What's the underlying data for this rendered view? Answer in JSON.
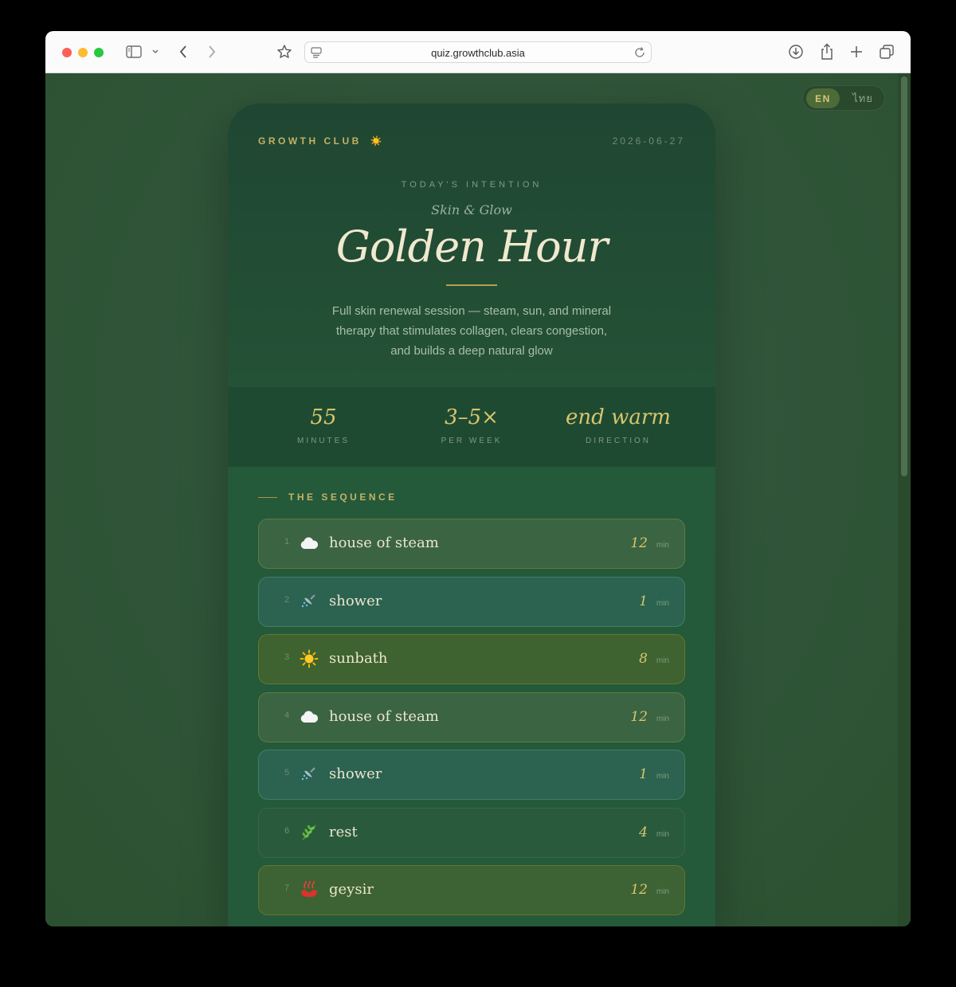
{
  "browser": {
    "url": "quiz.growthclub.asia"
  },
  "language_toggle": {
    "active": "EN",
    "other": "ไทย"
  },
  "card": {
    "brand": "GROWTH CLUB",
    "brand_icon": "☀️",
    "date": "2026-06-27",
    "intention_label": "TODAY'S INTENTION",
    "subtitle": "Skin & Glow",
    "title": "Golden Hour",
    "description": "Full skin renewal session — steam, sun, and mineral therapy that stimulates collagen, clears congestion, and builds a deep natural glow"
  },
  "stats": [
    {
      "value": "55",
      "label": "MINUTES"
    },
    {
      "value": "3–5×",
      "label": "PER WEEK"
    },
    {
      "value": "end warm",
      "label": "DIRECTION"
    }
  ],
  "sequence": {
    "label": "THE SEQUENCE",
    "steps": [
      {
        "num": "1",
        "icon": "cloud-icon",
        "name": "house of steam",
        "duration": "12",
        "unit": "min"
      },
      {
        "num": "2",
        "icon": "shower-icon",
        "name": "shower",
        "duration": "1",
        "unit": "min"
      },
      {
        "num": "3",
        "icon": "sun-icon",
        "name": "sunbath",
        "duration": "8",
        "unit": "min"
      },
      {
        "num": "4",
        "icon": "cloud-icon",
        "name": "house of steam",
        "duration": "12",
        "unit": "min"
      },
      {
        "num": "5",
        "icon": "shower-icon",
        "name": "shower",
        "duration": "1",
        "unit": "min"
      },
      {
        "num": "6",
        "icon": "herb-icon",
        "name": "rest",
        "duration": "4",
        "unit": "min"
      },
      {
        "num": "7",
        "icon": "hot-springs-icon",
        "name": "geysir",
        "duration": "12",
        "unit": "min"
      }
    ]
  },
  "colors": {
    "page_bg": "#2f5232",
    "card_bg": "#24593a",
    "gold": "#d8c66e",
    "title": "#f0e9cf"
  }
}
